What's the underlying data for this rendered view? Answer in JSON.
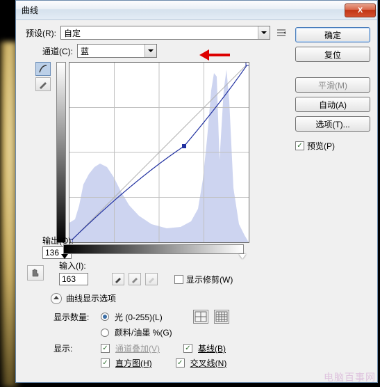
{
  "title": "曲线",
  "preset": {
    "label": "预设(R):",
    "value": "自定"
  },
  "channel": {
    "label": "通道(C):",
    "value": "蓝"
  },
  "buttons": {
    "ok": "确定",
    "reset": "复位",
    "smooth": "平滑(M)",
    "auto": "自动(A)",
    "options": "选项(T)..."
  },
  "preview": {
    "label": "预览(P)",
    "checked": true
  },
  "output": {
    "label": "输出(O):",
    "value": "136"
  },
  "input": {
    "label": "输入(I):",
    "value": "163"
  },
  "show_clipping": {
    "label": "显示修剪(W)",
    "checked": false
  },
  "options_header": "曲线显示选项",
  "amount": {
    "label": "显示数量:",
    "light": "光 (0-255)(L)",
    "pigment": "颜料/油墨 %(G)"
  },
  "show": {
    "label": "显示:",
    "channel_overlay": "通道叠加(V)",
    "baseline": "基线(B)",
    "histogram": "直方图(H)",
    "intersection": "交叉线(N)"
  },
  "chart_data": {
    "type": "line",
    "title": "",
    "xlabel": "输入",
    "ylabel": "输出",
    "xlim": [
      0,
      255
    ],
    "ylim": [
      0,
      255
    ],
    "series": [
      {
        "name": "curve",
        "points": [
          [
            0,
            0
          ],
          [
            163,
            136
          ],
          [
            255,
            255
          ]
        ]
      },
      {
        "name": "baseline",
        "points": [
          [
            0,
            0
          ],
          [
            255,
            255
          ]
        ]
      }
    ],
    "selected_point": [
      163,
      136
    ]
  },
  "watermark": "电脑百事网"
}
